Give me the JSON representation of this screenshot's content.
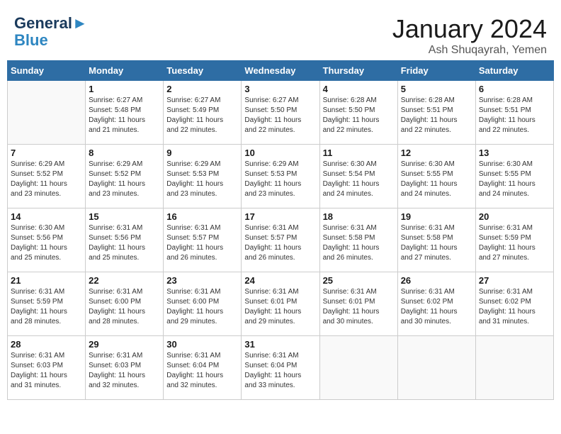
{
  "header": {
    "logo_line1": "General",
    "logo_line2": "Blue",
    "title": "January 2024",
    "subtitle": "Ash Shuqayrah, Yemen"
  },
  "days_of_week": [
    "Sunday",
    "Monday",
    "Tuesday",
    "Wednesday",
    "Thursday",
    "Friday",
    "Saturday"
  ],
  "weeks": [
    [
      {
        "day": "",
        "info": ""
      },
      {
        "day": "1",
        "info": "Sunrise: 6:27 AM\nSunset: 5:48 PM\nDaylight: 11 hours\nand 21 minutes."
      },
      {
        "day": "2",
        "info": "Sunrise: 6:27 AM\nSunset: 5:49 PM\nDaylight: 11 hours\nand 22 minutes."
      },
      {
        "day": "3",
        "info": "Sunrise: 6:27 AM\nSunset: 5:50 PM\nDaylight: 11 hours\nand 22 minutes."
      },
      {
        "day": "4",
        "info": "Sunrise: 6:28 AM\nSunset: 5:50 PM\nDaylight: 11 hours\nand 22 minutes."
      },
      {
        "day": "5",
        "info": "Sunrise: 6:28 AM\nSunset: 5:51 PM\nDaylight: 11 hours\nand 22 minutes."
      },
      {
        "day": "6",
        "info": "Sunrise: 6:28 AM\nSunset: 5:51 PM\nDaylight: 11 hours\nand 22 minutes."
      }
    ],
    [
      {
        "day": "7",
        "info": "Sunrise: 6:29 AM\nSunset: 5:52 PM\nDaylight: 11 hours\nand 23 minutes."
      },
      {
        "day": "8",
        "info": "Sunrise: 6:29 AM\nSunset: 5:52 PM\nDaylight: 11 hours\nand 23 minutes."
      },
      {
        "day": "9",
        "info": "Sunrise: 6:29 AM\nSunset: 5:53 PM\nDaylight: 11 hours\nand 23 minutes."
      },
      {
        "day": "10",
        "info": "Sunrise: 6:29 AM\nSunset: 5:53 PM\nDaylight: 11 hours\nand 23 minutes."
      },
      {
        "day": "11",
        "info": "Sunrise: 6:30 AM\nSunset: 5:54 PM\nDaylight: 11 hours\nand 24 minutes."
      },
      {
        "day": "12",
        "info": "Sunrise: 6:30 AM\nSunset: 5:55 PM\nDaylight: 11 hours\nand 24 minutes."
      },
      {
        "day": "13",
        "info": "Sunrise: 6:30 AM\nSunset: 5:55 PM\nDaylight: 11 hours\nand 24 minutes."
      }
    ],
    [
      {
        "day": "14",
        "info": "Sunrise: 6:30 AM\nSunset: 5:56 PM\nDaylight: 11 hours\nand 25 minutes."
      },
      {
        "day": "15",
        "info": "Sunrise: 6:31 AM\nSunset: 5:56 PM\nDaylight: 11 hours\nand 25 minutes."
      },
      {
        "day": "16",
        "info": "Sunrise: 6:31 AM\nSunset: 5:57 PM\nDaylight: 11 hours\nand 26 minutes."
      },
      {
        "day": "17",
        "info": "Sunrise: 6:31 AM\nSunset: 5:57 PM\nDaylight: 11 hours\nand 26 minutes."
      },
      {
        "day": "18",
        "info": "Sunrise: 6:31 AM\nSunset: 5:58 PM\nDaylight: 11 hours\nand 26 minutes."
      },
      {
        "day": "19",
        "info": "Sunrise: 6:31 AM\nSunset: 5:58 PM\nDaylight: 11 hours\nand 27 minutes."
      },
      {
        "day": "20",
        "info": "Sunrise: 6:31 AM\nSunset: 5:59 PM\nDaylight: 11 hours\nand 27 minutes."
      }
    ],
    [
      {
        "day": "21",
        "info": "Sunrise: 6:31 AM\nSunset: 5:59 PM\nDaylight: 11 hours\nand 28 minutes."
      },
      {
        "day": "22",
        "info": "Sunrise: 6:31 AM\nSunset: 6:00 PM\nDaylight: 11 hours\nand 28 minutes."
      },
      {
        "day": "23",
        "info": "Sunrise: 6:31 AM\nSunset: 6:00 PM\nDaylight: 11 hours\nand 29 minutes."
      },
      {
        "day": "24",
        "info": "Sunrise: 6:31 AM\nSunset: 6:01 PM\nDaylight: 11 hours\nand 29 minutes."
      },
      {
        "day": "25",
        "info": "Sunrise: 6:31 AM\nSunset: 6:01 PM\nDaylight: 11 hours\nand 30 minutes."
      },
      {
        "day": "26",
        "info": "Sunrise: 6:31 AM\nSunset: 6:02 PM\nDaylight: 11 hours\nand 30 minutes."
      },
      {
        "day": "27",
        "info": "Sunrise: 6:31 AM\nSunset: 6:02 PM\nDaylight: 11 hours\nand 31 minutes."
      }
    ],
    [
      {
        "day": "28",
        "info": "Sunrise: 6:31 AM\nSunset: 6:03 PM\nDaylight: 11 hours\nand 31 minutes."
      },
      {
        "day": "29",
        "info": "Sunrise: 6:31 AM\nSunset: 6:03 PM\nDaylight: 11 hours\nand 32 minutes."
      },
      {
        "day": "30",
        "info": "Sunrise: 6:31 AM\nSunset: 6:04 PM\nDaylight: 11 hours\nand 32 minutes."
      },
      {
        "day": "31",
        "info": "Sunrise: 6:31 AM\nSunset: 6:04 PM\nDaylight: 11 hours\nand 33 minutes."
      },
      {
        "day": "",
        "info": ""
      },
      {
        "day": "",
        "info": ""
      },
      {
        "day": "",
        "info": ""
      }
    ]
  ]
}
